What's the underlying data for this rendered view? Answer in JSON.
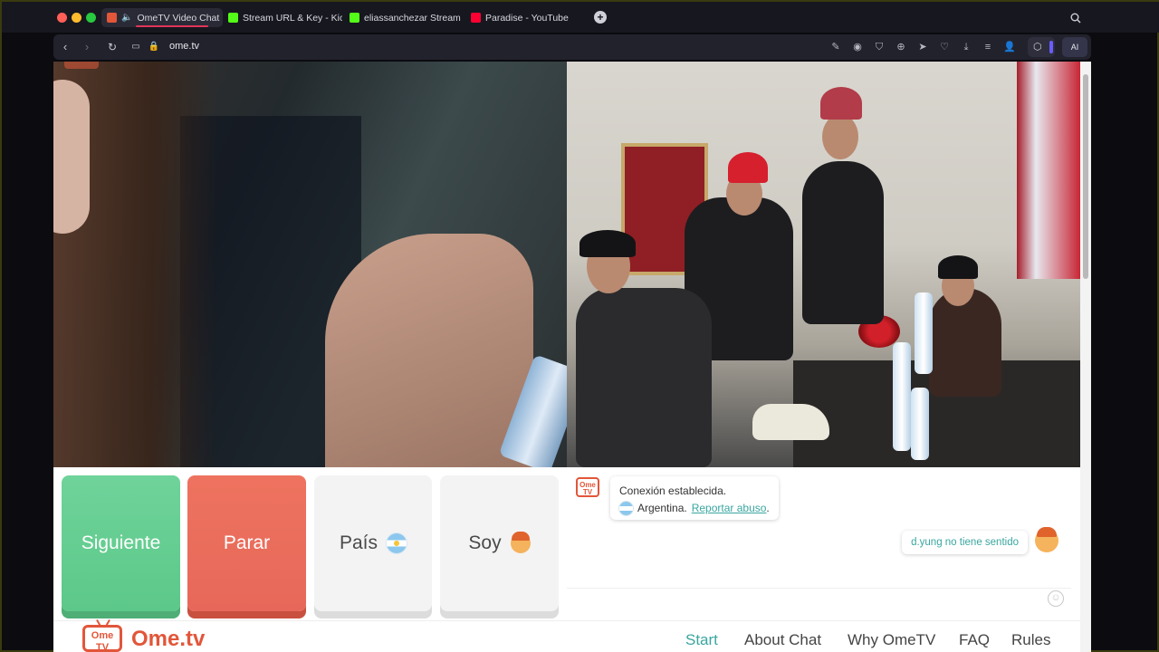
{
  "browser": {
    "tabs": [
      {
        "label": "OmeTV Video Chat",
        "active": true,
        "favicon_color": "#e2563a"
      },
      {
        "label": "Stream URL & Key - Kick",
        "active": false,
        "favicon_color": "#53fc18"
      },
      {
        "label": "eliassanchezar Stream",
        "active": false,
        "favicon_color": "#53fc18"
      },
      {
        "label": "Paradise - YouTube",
        "active": false,
        "favicon_color": "#ff0033"
      }
    ],
    "new_tab": "+",
    "url": "ome.tv",
    "ai_label": "AI"
  },
  "buttons": {
    "next": "Siguiente",
    "stop": "Parar",
    "country": "País",
    "me": "Soy"
  },
  "chat": {
    "badge": "Ome TV",
    "system_title": "Conexión establecida.",
    "country": "Argentina.",
    "report": "Reportar abuso",
    "report_suffix": ".",
    "my_message": "d.yung no tiene sentido"
  },
  "footer": {
    "logo_badge": "Ome TV",
    "logo_text": "Ome.tv",
    "nav": [
      "Start",
      "About Chat",
      "Why OmeTV",
      "FAQ",
      "Rules"
    ]
  },
  "colors": {
    "next": "#5cc889",
    "stop": "#e7685a",
    "brand": "#e2563a",
    "accent": "#3aa6a0"
  }
}
